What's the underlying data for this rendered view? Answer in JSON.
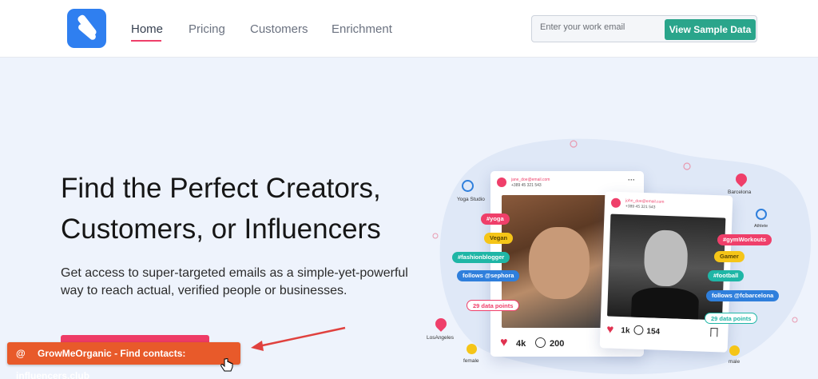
{
  "header": {
    "nav": [
      {
        "label": "Home",
        "active": true
      },
      {
        "label": "Pricing",
        "active": false
      },
      {
        "label": "Customers",
        "active": false
      },
      {
        "label": "Enrichment",
        "active": false
      }
    ],
    "email_placeholder": "Enter your work email",
    "cta_label": "View Sample Data"
  },
  "hero": {
    "title_line1": "Find the Perfect Creators,",
    "title_line2": "Customers, or Influencers",
    "subtitle": "Get access to super-targeted emails as a simple-yet-powerful way to reach actual, verified people or businesses."
  },
  "extension_button": {
    "icon": "@",
    "label": "GrowMeOrganic - Find contacts: influencers.club"
  },
  "illustration": {
    "card1": {
      "email": "jane_doe@email.com",
      "phone": "+389 45 321 543",
      "likes": "4k",
      "comments": "200"
    },
    "card2": {
      "email": "john_doe@email.com",
      "phone": "+389 45 321 543",
      "likes": "1k",
      "comments": "154"
    },
    "tags_left": [
      "#yoga",
      "Vegan",
      "#fashionblogger",
      "follows @sephora",
      "29 data points"
    ],
    "tags_right": [
      "#gymWorkouts",
      "Gamer",
      "#football",
      "follows @fcbarcelona",
      "29 data points"
    ],
    "labels": {
      "yoga_studio": "Yoga Studio",
      "barcelona": "Barcelona",
      "athlete": "Athlete",
      "los_angeles": "LosAngeles",
      "female": "female",
      "male": "male"
    },
    "colors": {
      "pink": "#ef3f6a",
      "yellow": "#f5c518",
      "teal": "#1fb6a6",
      "blue": "#2f7fdc",
      "green": "#2aa58b"
    }
  }
}
